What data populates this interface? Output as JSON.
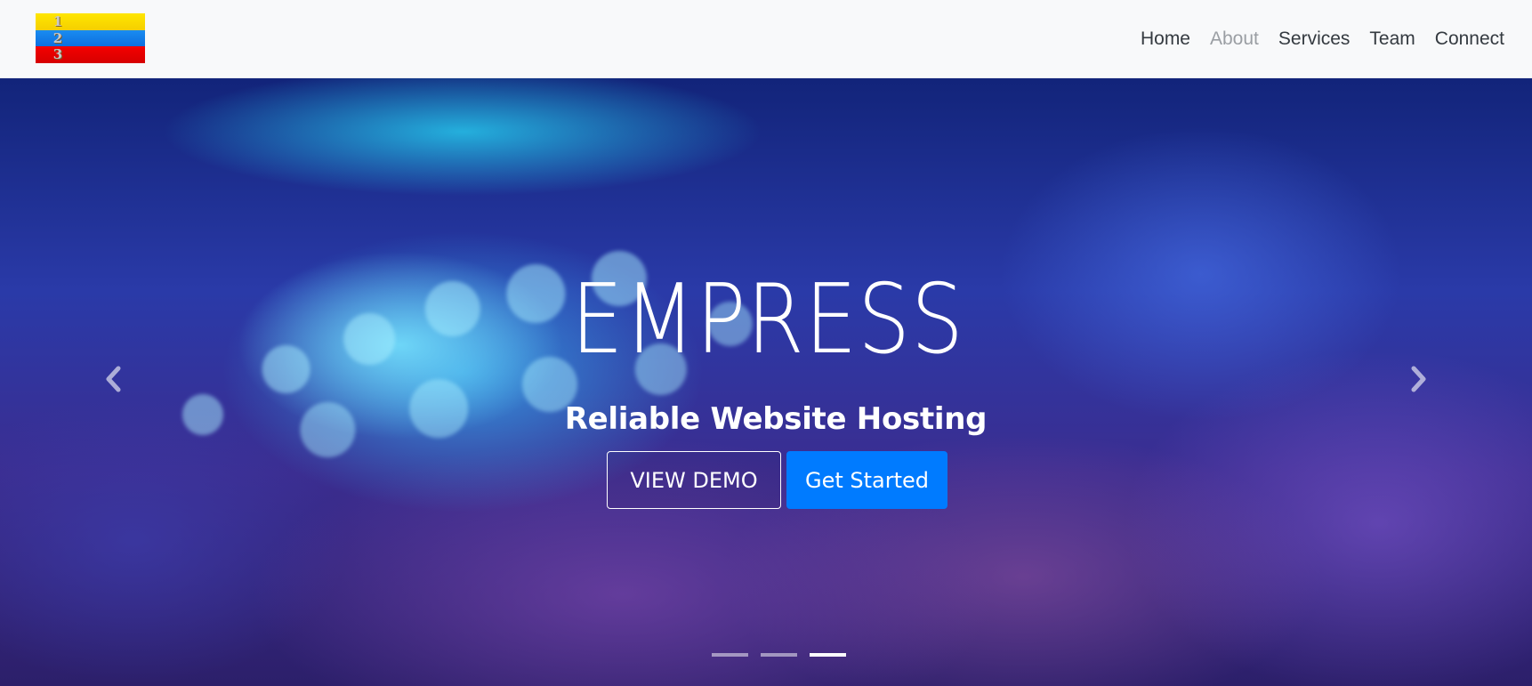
{
  "navbar": {
    "logo": {
      "digits": [
        "1",
        "2",
        "3"
      ]
    },
    "links": [
      {
        "label": "Home",
        "active": false
      },
      {
        "label": "About",
        "active": true
      },
      {
        "label": "Services",
        "active": false
      },
      {
        "label": "Team",
        "active": false
      },
      {
        "label": "Connect",
        "active": false
      }
    ]
  },
  "hero": {
    "title": "EMPRESS",
    "subtitle": "Reliable Website Hosting",
    "buttons": {
      "demo_label": "VIEW DEMO",
      "start_label": "Get Started"
    },
    "controls": {
      "prev_icon": "chevron-left-icon",
      "next_icon": "chevron-right-icon"
    },
    "slide_count": 3,
    "active_slide": 3
  },
  "colors": {
    "primary": "#007bff",
    "nav_text": "#343a40",
    "nav_active": "#9a9ea3",
    "navbar_bg": "#f8f9fa"
  }
}
